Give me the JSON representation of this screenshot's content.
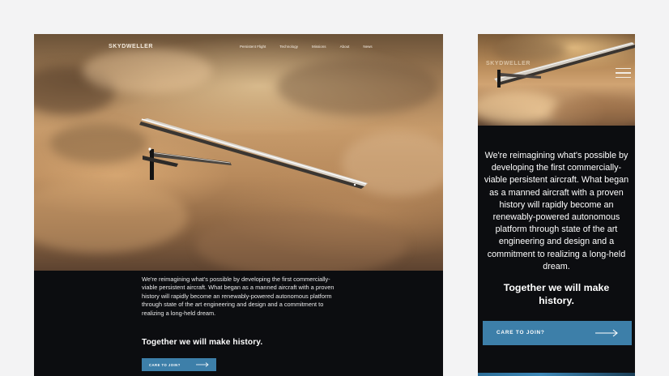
{
  "desktop": {
    "logo": "SKYDWELLER",
    "nav": [
      "Persistent Flight",
      "Technology",
      "Missions",
      "About",
      "News"
    ],
    "paragraph": "We're reimagining what's possible by developing the first commercially-viable persistent aircraft. What began as a manned aircraft with a proven history will rapidly become an renewably-powered autonomous platform through state of the art engineering and design and a commitment to realizing a long-held dream.",
    "headline": "Together we will make history.",
    "cta_label": "CARE TO JOIN?"
  },
  "mobile": {
    "logo": "SKYDWELLER",
    "paragraph": "We're reimagining what's possible by developing the first commercially-viable persistent aircraft. What began as a manned aircraft with a proven history will rapidly become an renewably-powered autonomous platform through state of the art engineering and design and a commitment to realizing a long-held dream.",
    "headline": "Together we will make history.",
    "cta_label": "CARE TO JOIN?"
  },
  "colors": {
    "page_bg": "#f3f3f4",
    "dark_bg": "#0c0d10",
    "accent": "#3d7fa9",
    "text": "#ffffff"
  },
  "icons": {
    "cta_arrow": "arrow-right-icon",
    "menu": "hamburger-menu-icon"
  }
}
